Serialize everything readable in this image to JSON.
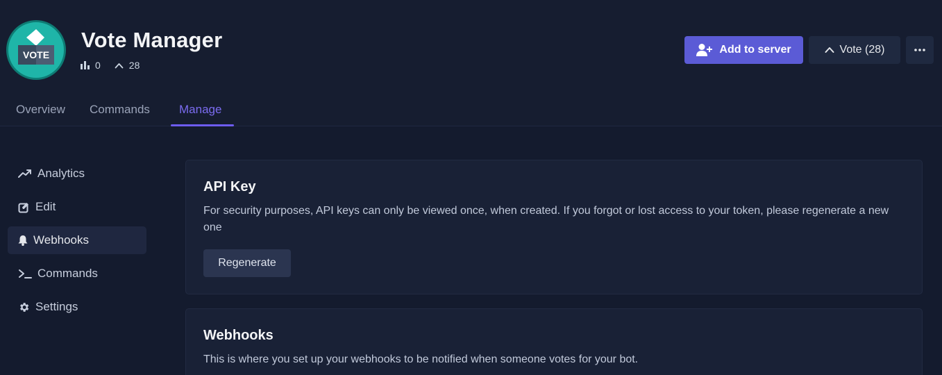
{
  "app": {
    "name": "Vote Manager",
    "logo_text": "VOTE",
    "stats": {
      "servers": "0",
      "votes": "28"
    }
  },
  "actions": {
    "add_label": "Add to server",
    "vote_label": "Vote (28)"
  },
  "tabs": [
    {
      "label": "Overview",
      "active": false
    },
    {
      "label": "Commands",
      "active": false
    },
    {
      "label": "Manage",
      "active": true
    }
  ],
  "sidebar": {
    "items": [
      {
        "label": "Analytics",
        "icon": "trending-up-icon",
        "active": false
      },
      {
        "label": "Edit",
        "icon": "edit-icon",
        "active": false
      },
      {
        "label": "Webhooks",
        "icon": "bell-icon",
        "active": true
      },
      {
        "label": "Commands",
        "icon": "terminal-icon",
        "active": false
      },
      {
        "label": "Settings",
        "icon": "gear-icon",
        "active": false
      }
    ]
  },
  "api_key": {
    "title": "API Key",
    "description": "For security purposes, API keys can only be viewed once, when created. If you forgot or lost access to your token, please regenerate a new one",
    "button": "Regenerate"
  },
  "webhooks": {
    "title": "Webhooks",
    "description": "This is where you set up your webhooks to be notified when someone votes for your bot."
  },
  "colors": {
    "background": "#141b2e",
    "accent": "#6d5cf0",
    "primary_button": "#5b5bd6",
    "logo": "#1fb5a8"
  }
}
